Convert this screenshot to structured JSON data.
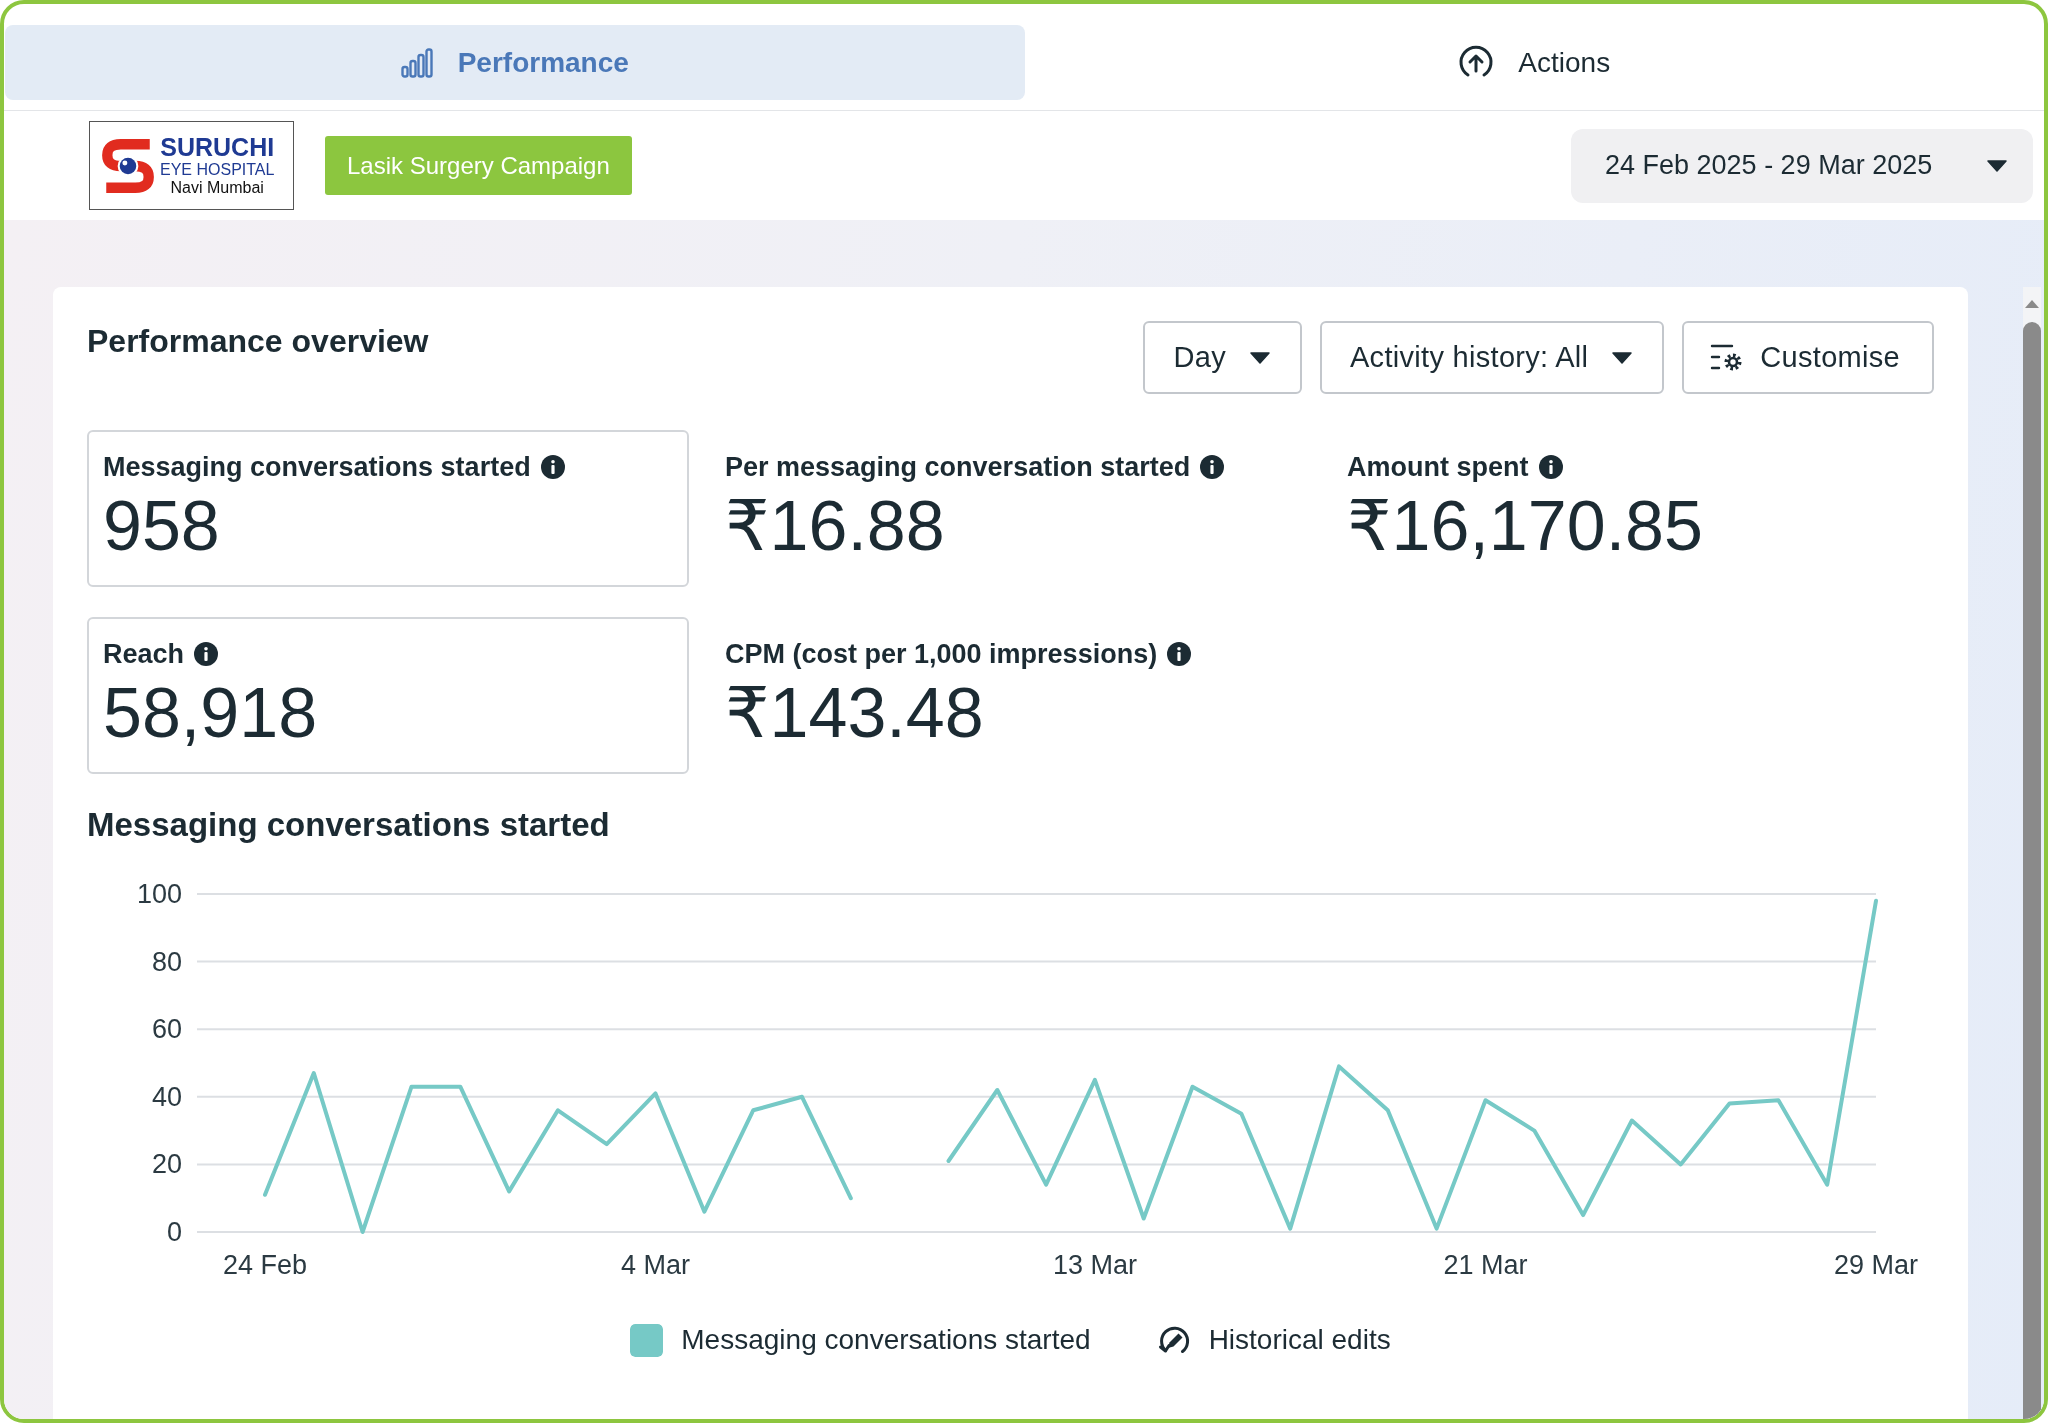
{
  "tabs": [
    {
      "label": "Performance",
      "selected": true
    },
    {
      "label": "Actions",
      "selected": false
    }
  ],
  "header": {
    "logo": {
      "name": "SURUCHI",
      "subtitle": "EYE HOSPITAL",
      "location": "Navi Mumbai"
    },
    "campaign": "Lasik Surgery Campaign",
    "date_range": "24 Feb 2025 - 29 Mar 2025"
  },
  "overview": {
    "title": "Performance overview",
    "controls": [
      {
        "kind": "dropdown",
        "label": "Day"
      },
      {
        "kind": "dropdown",
        "label": "Activity history: All"
      },
      {
        "kind": "button",
        "label": "Customise"
      }
    ],
    "metrics": [
      {
        "label": "Messaging conversations started",
        "value": "958",
        "selected": true
      },
      {
        "label": "Per messaging conversation started",
        "value": "₹16.88",
        "selected": false
      },
      {
        "label": "Amount spent",
        "value": "₹16,170.85",
        "selected": false
      },
      {
        "label": "Reach",
        "value": "58,918",
        "selected": true
      },
      {
        "label": "CPM (cost per 1,000 impressions)",
        "value": "₹143.48",
        "selected": false
      }
    ],
    "chart": {
      "chart_data": {
        "type": "line",
        "title": "Messaging conversations started",
        "categories": [
          "24 Feb",
          null,
          null,
          null,
          null,
          null,
          null,
          null,
          "4 Mar",
          null,
          null,
          null,
          null,
          null,
          null,
          null,
          null,
          "13 Mar",
          null,
          null,
          null,
          null,
          null,
          null,
          null,
          "21 Mar",
          null,
          null,
          null,
          null,
          null,
          null,
          null,
          "29 Mar"
        ],
        "ylim": [
          0,
          100
        ],
        "yticks": [
          0,
          20,
          40,
          60,
          80,
          100
        ],
        "grid": true,
        "series": [
          {
            "name": "Messaging conversations started",
            "color": "#76c9c6",
            "values": [
              11,
              47,
              0,
              43,
              43,
              12,
              36,
              26,
              41,
              6,
              36,
              40,
              10,
              null,
              21,
              42,
              14,
              45,
              4,
              43,
              35,
              1,
              49,
              36,
              1,
              39,
              30,
              5,
              33,
              20,
              38,
              39,
              14,
              98
            ]
          }
        ]
      },
      "historical_edits_label": "Historical edits"
    }
  }
}
